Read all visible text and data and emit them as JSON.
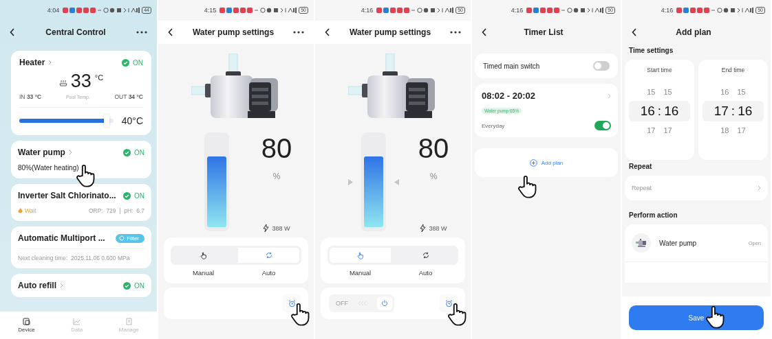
{
  "screens": [
    {
      "kind": "central",
      "status_bar": {
        "time": "4:04",
        "battery": "44"
      },
      "title": "Central Control",
      "heater": {
        "name": "Heater",
        "on": true,
        "status": "ON",
        "temperature": "33",
        "unit": "°C",
        "inlet": "IN **33 °C**",
        "caption": "Pool Temp.",
        "outlet": "OUT **34 °C**",
        "level": 0.93,
        "setpoint": "40°C"
      },
      "devices": [
        {
          "kind": "status",
          "name": "Water pump",
          "link": true,
          "on": true,
          "status": "ON",
          "detail": "80%(Water heating)"
        },
        {
          "kind": "reading",
          "name": "Inverter Salt Chlorinato...",
          "link": false,
          "on": true,
          "status": "ON",
          "warning": "Wait",
          "reading": "ORP:  729  |  pH:  6.7"
        },
        {
          "kind": "badge",
          "name": "Automatic Multiport ...",
          "link": false,
          "badge": "Filter",
          "detail": "Next cleaning time:  2025.11.06 0.600 MPa"
        },
        {
          "kind": "status",
          "name": "Auto refill",
          "link": true,
          "on": true,
          "status": "ON"
        }
      ],
      "nav": [
        {
          "label": "Device",
          "selected": true
        },
        {
          "label": "Data",
          "selected": false
        },
        {
          "label": "Manage",
          "selected": false
        }
      ]
    },
    {
      "kind": "pump",
      "status_bar": {
        "time": "4:15",
        "battery": "50"
      },
      "title": "Water pump settings",
      "level": 0.75,
      "arrows": false,
      "value": "80",
      "unit": "%",
      "power": "388 W",
      "modes": [
        {
          "label": "Manual",
          "selected": false
        },
        {
          "label": "Auto",
          "selected": true
        }
      ]
    },
    {
      "kind": "pump",
      "status_bar": {
        "time": "4:16",
        "battery": "50"
      },
      "title": "Water pump settings",
      "level": 0.75,
      "arrows": true,
      "value": "80",
      "unit": "%",
      "power": "388 W",
      "modes": [
        {
          "label": "Manual",
          "selected": true
        },
        {
          "label": "Auto",
          "selected": false
        }
      ],
      "switch": {
        "label": "OFF",
        "on": false
      }
    },
    {
      "kind": "timers",
      "status_bar": {
        "time": "4:16",
        "battery": "50"
      },
      "title": "Timer List",
      "main_switch": {
        "label": "Timed main switch",
        "on": false
      },
      "timers": [
        {
          "time": "08:02 - 20:02",
          "tag": "Water pump:65%",
          "repeat": "Everyday",
          "on": true
        }
      ],
      "add_label": "Add plan"
    },
    {
      "kind": "plan",
      "status_bar": {
        "time": "4:16",
        "battery": "50"
      },
      "title": "Add plan",
      "time_heading": "Time settings",
      "pickers": [
        {
          "label": "Start time",
          "separator": ":",
          "rows": [
            {
              "values": [
                "15",
                "15"
              ],
              "selected": false
            },
            {
              "values": [
                "16",
                "16"
              ],
              "selected": true
            },
            {
              "values": [
                "17",
                "17"
              ],
              "selected": false
            }
          ]
        },
        {
          "label": "End time",
          "separator": ":",
          "rows": [
            {
              "values": [
                "16",
                "15"
              ],
              "selected": false
            },
            {
              "values": [
                "17",
                "16"
              ],
              "selected": true
            },
            {
              "values": [
                "18",
                "17"
              ],
              "selected": false
            }
          ]
        }
      ],
      "repeat_heading": "Repeat",
      "repeat_placeholder": "Repeat",
      "action_heading": "Perform action",
      "action": {
        "name": "Water pump",
        "state": "Open"
      },
      "save": "Save"
    }
  ]
}
